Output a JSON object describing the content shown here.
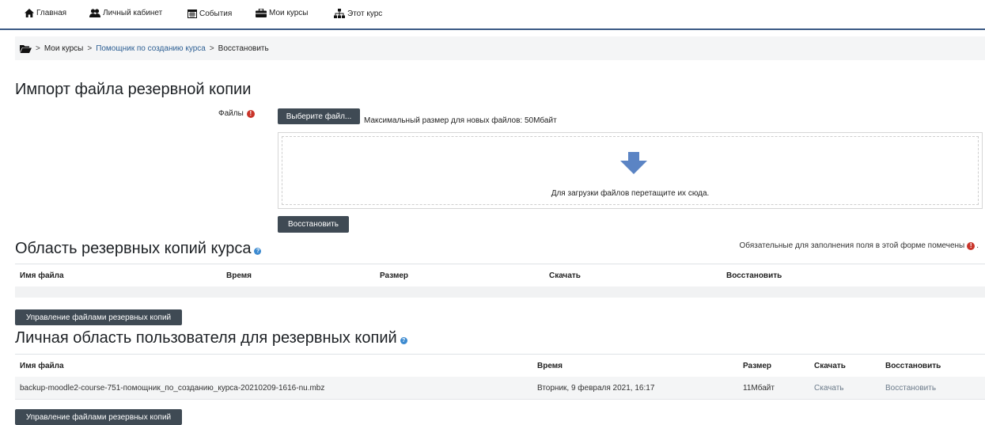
{
  "navbar": {
    "home": "Главная",
    "dashboard": "Личный кабинет",
    "events": "События",
    "my_courses": "Мои курсы",
    "this_course": "Этот курс"
  },
  "breadcrumb": {
    "items": [
      "Мои курсы",
      "Помощник по созданию курса",
      "Восстановить"
    ],
    "separator": ">"
  },
  "import_section": {
    "title": "Импорт файла резервной копии",
    "files_label": "Файлы",
    "choose_file_button": "Выберите файл...",
    "max_size_text": "Максимальный размер для новых файлов: 50Мбайт",
    "drop_text": "Для загрузки файлов перетащите их сюда.",
    "restore_button": "Восстановить"
  },
  "course_backup_section": {
    "title": "Область резервных копий курса",
    "required_note": "Обязательные для заполнения поля в этой форме помечены",
    "columns": [
      "Имя файла",
      "Время",
      "Размер",
      "Скачать",
      "Восстановить"
    ],
    "manage_button": "Управление файлами резервных копий"
  },
  "user_backup_section": {
    "title": "Личная область пользователя для резервных копий",
    "columns": [
      "Имя файла",
      "Время",
      "Размер",
      "Скачать",
      "Восстановить"
    ],
    "rows": [
      {
        "filename": "backup-moodle2-course-751-помощник_по_созданию_курса-20210209-1616-nu.mbz",
        "time": "Вторник, 9 февраля 2021, 16:17",
        "size": "11Мбайт",
        "download": "Скачать",
        "restore": "Восстановить"
      }
    ],
    "manage_button": "Управление файлами резервных копий"
  },
  "colors": {
    "button_bg": "#3f4a54",
    "navbar_border": "#3b5a85",
    "link": "#2d5f93",
    "required": "#c9342a",
    "help": "#3c8ad0",
    "drop_arrow": "#5b84c4"
  }
}
